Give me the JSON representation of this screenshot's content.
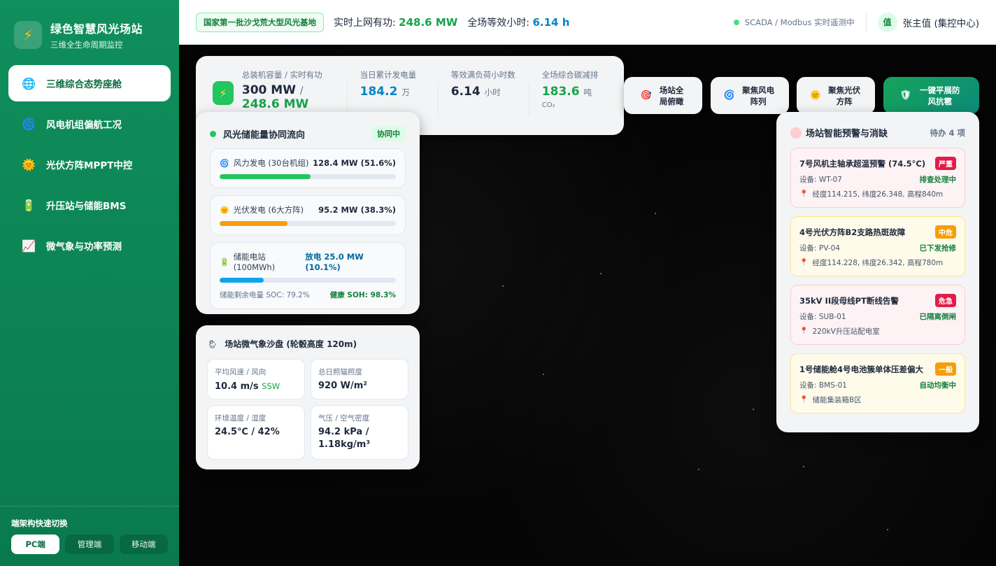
{
  "brand": {
    "title": "绿色智慧风光场站",
    "subtitle": "三维全生命周期监控",
    "logo_icon": "lightning-icon"
  },
  "nav": [
    {
      "label": "三维综合态势座舱",
      "icon": "globe-icon",
      "glyph": "🌐",
      "active": true
    },
    {
      "label": "风电机组偏航工况",
      "icon": "cyclone-icon",
      "glyph": "🌀",
      "active": false
    },
    {
      "label": "光伏方阵MPPT中控",
      "icon": "sun-icon",
      "glyph": "🌞",
      "active": false
    },
    {
      "label": "升压站与储能BMS",
      "icon": "battery-icon",
      "glyph": "🔋",
      "active": false
    },
    {
      "label": "微气象与功率预测",
      "icon": "chart-icon",
      "glyph": "📈",
      "active": false
    }
  ],
  "switcher": {
    "title": "端架构快速切换",
    "options": [
      "PC端",
      "管理端",
      "移动端"
    ],
    "active": "PC端"
  },
  "header": {
    "tag": "国家第一批沙戈荒大型风光基地",
    "power_label": "实时上网有功:",
    "power_value": "248.6 MW",
    "hours_label": "全场等效小时:",
    "hours_value": "6.14 h",
    "scada": "SCADA / Modbus 实时遥测中",
    "avatar": "值",
    "user": "张主值 (集控中心)"
  },
  "kpi": {
    "capacity_label": "总装机容量 / 实时有功",
    "capacity_value": "300 MW",
    "active_value": "248.6 MW",
    "daily_label": "当日累计发电量",
    "daily_value": "184.2",
    "daily_unit": "万",
    "hours_label": "等效满负荷小时数",
    "hours_value": "6.14",
    "hours_unit": "小时",
    "carbon_label": "全场综合碳减排",
    "carbon_value": "183.6",
    "carbon_unit": "吨",
    "carbon_sub": "CO₂"
  },
  "actions": [
    {
      "label": "场站全局俯瞰",
      "icon": "target-icon",
      "glyph": "🎯"
    },
    {
      "label": "聚焦风电阵列",
      "icon": "cyclone-icon",
      "glyph": "🌀"
    },
    {
      "label": "聚焦光伏方阵",
      "icon": "sun-icon",
      "glyph": "🌞"
    },
    {
      "label": "一键平展防风抗雹",
      "icon": "shield-icon",
      "glyph": "🛡"
    }
  ],
  "flow": {
    "title": "风光储能量协同流向",
    "status": "协同中",
    "items": [
      {
        "label": "风力发电 (30台机组)",
        "value": "128.4 MW (51.6%)",
        "percent": 51.6,
        "color": "#22c55e",
        "glyph": "🌀",
        "icon": "cyclone-icon"
      },
      {
        "label": "光伏发电 (6大方阵)",
        "value": "95.2 MW (38.3%)",
        "percent": 38.3,
        "color": "#f59e0b",
        "glyph": "🌞",
        "icon": "sun-icon"
      },
      {
        "label": "储能电站 (100MWh)",
        "value": "放电 25.0 MW (10.1%)",
        "percent": 25.0,
        "color": "#0ea5e9",
        "glyph": "🔋",
        "icon": "battery-icon"
      }
    ],
    "soc": "储能剩余电量 SOC: 79.2%",
    "soh": "健康 SOH: 98.3%"
  },
  "weather": {
    "title": "场站微气象沙盘 (轮毂高度 120m)",
    "icon": "weather-icon",
    "cells": [
      {
        "label": "平均风速 / 风向",
        "value": "10.4 m/s",
        "extra": "SSW"
      },
      {
        "label": "总日照辐照度",
        "value": "920 W/m²",
        "extra": ""
      },
      {
        "label": "环境温度 / 湿度",
        "value": "24.5℃ / 42%",
        "extra": ""
      },
      {
        "label": "气压 / 空气密度",
        "value": "94.2 kPa / 1.18kg/m³",
        "extra": ""
      }
    ]
  },
  "alerts": {
    "title": "场站智能预警与消缺",
    "pending": "待办 4 项",
    "items": [
      {
        "title": "7号风机主轴承超温预警 (74.5°C)",
        "level": "严重",
        "level_color": "#e11d48",
        "device": "设备: WT-07",
        "status": "排查处理中",
        "location": "经度114.215, 纬度26.348, 高程840m",
        "tone": "red"
      },
      {
        "title": "4号光伏方阵B2支路热斑故障",
        "level": "中危",
        "level_color": "#f59e0b",
        "device": "设备: PV-04",
        "status": "已下发抢修",
        "location": "经度114.228, 纬度26.342, 高程780m",
        "tone": "yellow"
      },
      {
        "title": "35kV II段母线PT断线告警",
        "level": "危急",
        "level_color": "#e11d48",
        "device": "设备: SUB-01",
        "status": "已隔离倒闸",
        "location": "220kV升压站配电室",
        "tone": "red"
      },
      {
        "title": "1号储能舱4号电池簇单体压差偏大",
        "level": "一般",
        "level_color": "#f59e0b",
        "device": "设备: BMS-01",
        "status": "自动均衡中",
        "location": "储能集装箱B区",
        "tone": "yellow"
      }
    ]
  }
}
